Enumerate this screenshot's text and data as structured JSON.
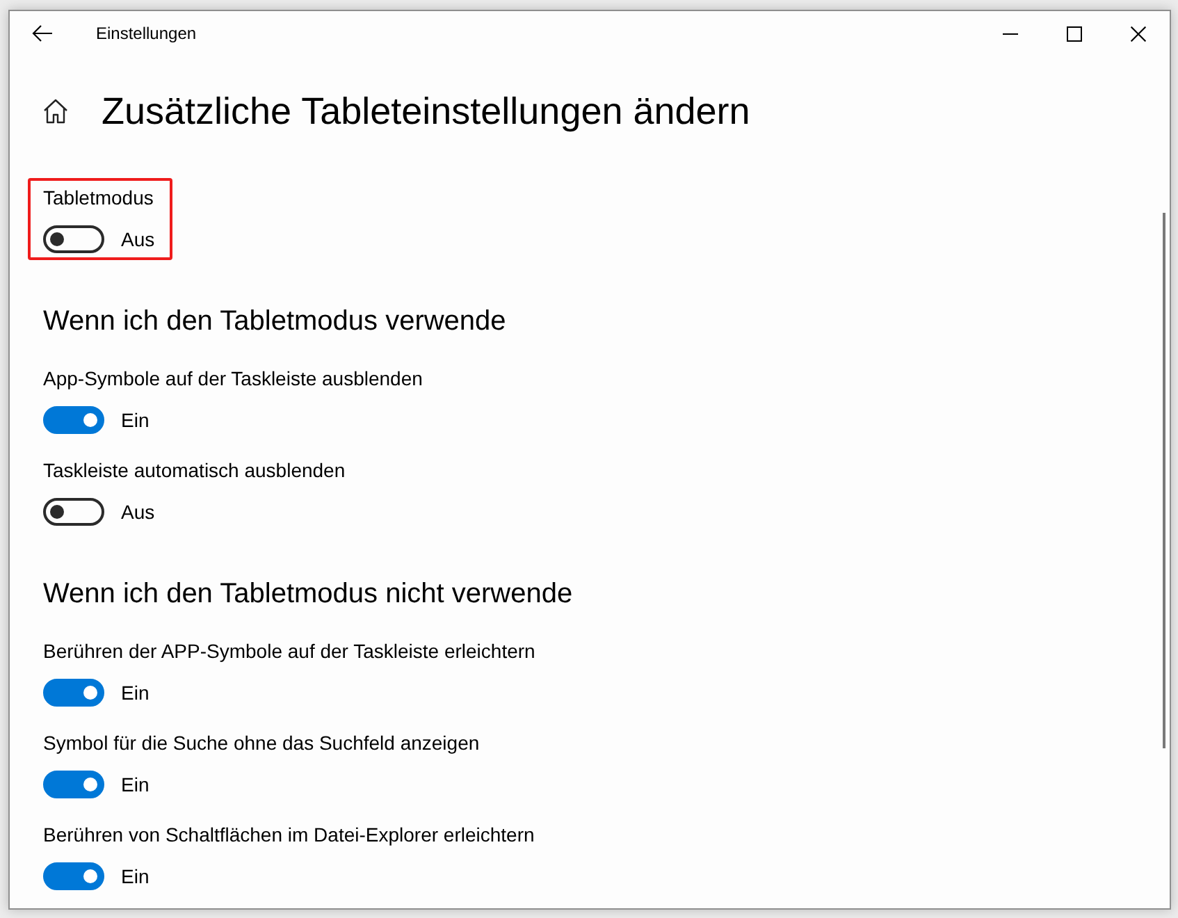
{
  "window": {
    "title": "Einstellungen"
  },
  "page": {
    "title": "Zusätzliche Tableteinstellungen ändern"
  },
  "main_setting": {
    "label": "Tabletmodus",
    "on": false,
    "state_text": "Aus",
    "highlighted": true
  },
  "sections": [
    {
      "heading": "Wenn ich den Tabletmodus verwende",
      "settings": [
        {
          "label": "App-Symbole auf der Taskleiste ausblenden",
          "on": true,
          "state_text": "Ein"
        },
        {
          "label": "Taskleiste automatisch ausblenden",
          "on": false,
          "state_text": "Aus"
        }
      ]
    },
    {
      "heading": "Wenn ich den Tabletmodus nicht verwende",
      "settings": [
        {
          "label": "Berühren der APP-Symbole auf der Taskleiste erleichtern",
          "on": true,
          "state_text": "Ein"
        },
        {
          "label": "Symbol für die Suche ohne das Suchfeld anzeigen",
          "on": true,
          "state_text": "Ein"
        },
        {
          "label": "Berühren von Schaltflächen im Datei-Explorer erleichtern",
          "on": true,
          "state_text": "Ein"
        }
      ]
    }
  ]
}
